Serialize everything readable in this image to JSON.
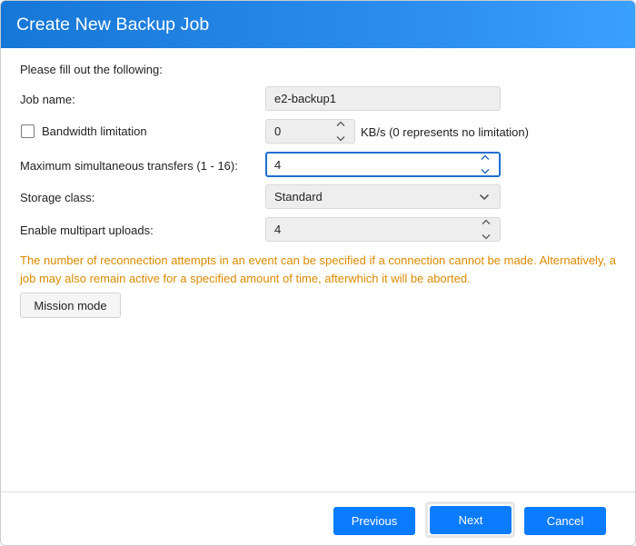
{
  "dialog": {
    "title": "Create New Backup Job"
  },
  "form": {
    "intro": "Please fill out the following:",
    "job_name": {
      "label": "Job name:",
      "value": "e2-backup1"
    },
    "bandwidth": {
      "label": "Bandwidth limitation",
      "checked": false,
      "value": "0",
      "unit_note": "KB/s (0 represents no limitation)"
    },
    "max_transfers": {
      "label": "Maximum simultaneous transfers (1 - 16):",
      "value": "4"
    },
    "storage_class": {
      "label": "Storage class:",
      "value": "Standard"
    },
    "multipart": {
      "label": "Enable multipart uploads:",
      "value": "4"
    },
    "note": "The number of reconnection attempts in an event can be specified if a connection cannot be made. Alternatively, a job may also remain active for a specified amount of time, afterwhich it will be aborted.",
    "mission_mode_label": "Mission mode"
  },
  "footer": {
    "previous_label": "Previous",
    "next_label": "Next",
    "cancel_label": "Cancel"
  },
  "colors": {
    "title_bar": "#1677d6",
    "primary_button": "#0b7bff",
    "note_text": "#d98b00",
    "focus_border": "#1d6fd1"
  }
}
